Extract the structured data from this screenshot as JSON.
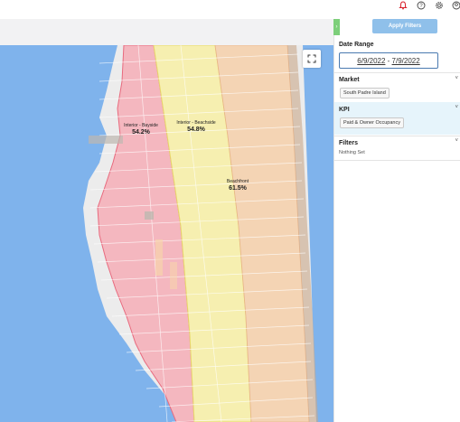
{
  "topbar": {
    "icons": [
      "bell-icon",
      "help-icon",
      "settings-icon",
      "account-icon"
    ],
    "bell_color": "#d9232e"
  },
  "map": {
    "zones": [
      {
        "name": "Interior - Bayside",
        "value": "54.2%",
        "color": "#f4b7bf"
      },
      {
        "name": "Interior - Beachside",
        "value": "54.8%",
        "color": "#f6efb0"
      },
      {
        "name": "Beachfront",
        "value": "61.5%",
        "color": "#f4d4b4"
      }
    ],
    "water_color": "#7fb3ec",
    "land_color": "#ececec"
  },
  "panel": {
    "apply_label": "Apply Filters",
    "date_range": {
      "title": "Date Range",
      "start": "6/9/2022",
      "sep": " - ",
      "end": "7/9/2022"
    },
    "market": {
      "title": "Market",
      "value": "South Padre Island"
    },
    "kpi": {
      "title": "KPI",
      "value": "Paid & Owner Occupancy"
    },
    "filters": {
      "title": "Filters",
      "value": "Nothing Set"
    }
  }
}
